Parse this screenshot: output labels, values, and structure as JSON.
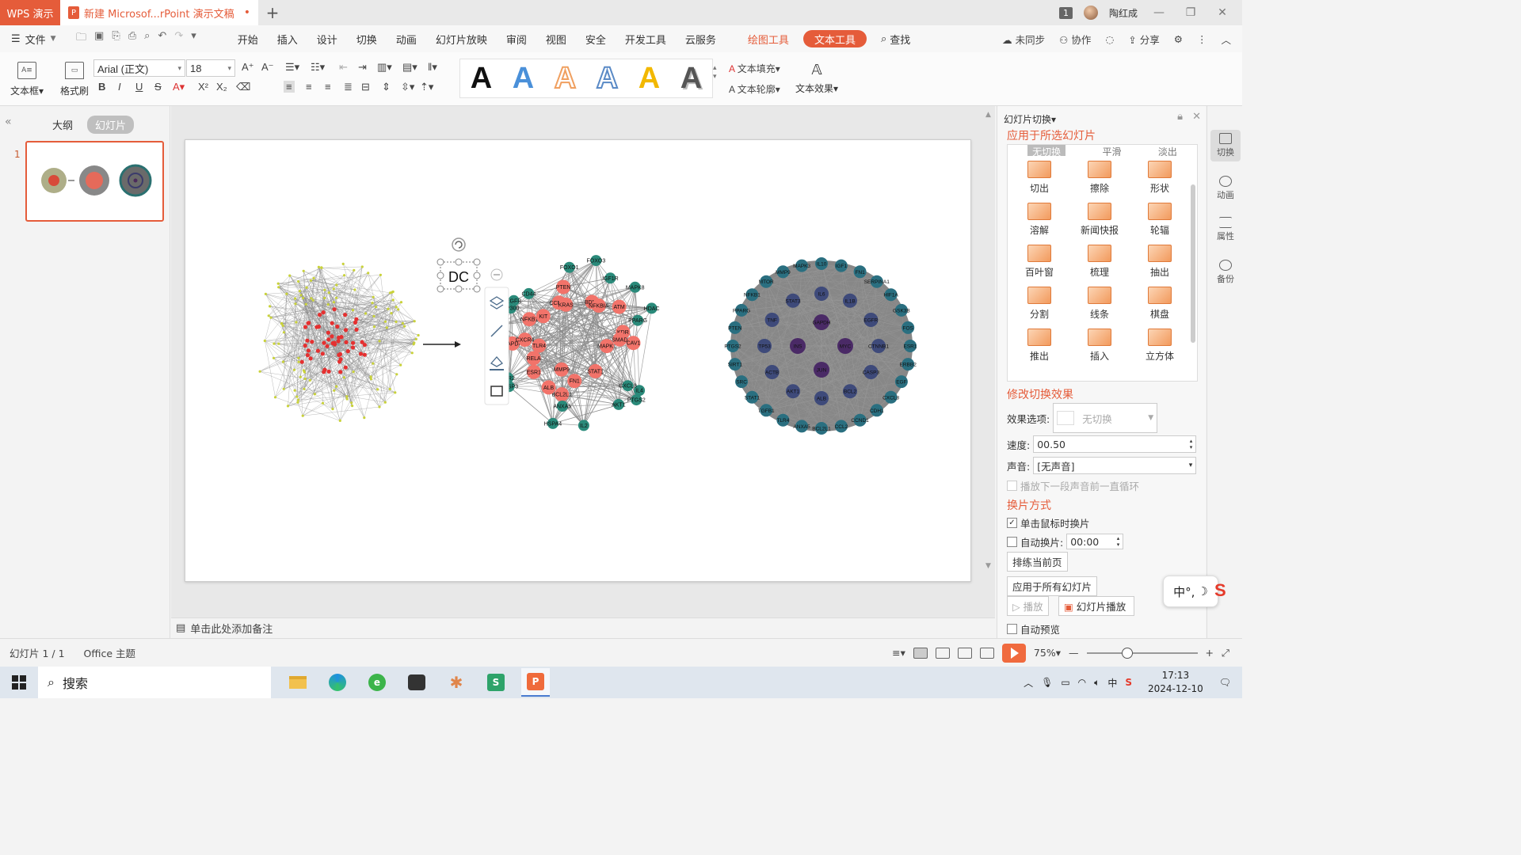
{
  "titlebar": {
    "app_tab": "WPS 演示",
    "doc_tab": "新建 Microsof...rPoint 演示文稿",
    "page_badge": "1",
    "user_name": "陶红成"
  },
  "menu": {
    "file": "文件",
    "tabs": [
      "开始",
      "插入",
      "设计",
      "切换",
      "动画",
      "幻灯片放映",
      "审阅",
      "视图",
      "安全",
      "开发工具",
      "云服务"
    ],
    "draw_tools": "绘图工具",
    "text_tools": "文本工具",
    "search": "查找",
    "right": [
      "未同步",
      "协作",
      "分享"
    ]
  },
  "ribbon": {
    "textbox": "文本框",
    "format_painter": "格式刷",
    "font_name": "Arial (正文)",
    "font_size": "18",
    "text_fill": "文本填充",
    "text_outline": "文本轮廓",
    "text_effect": "文本效果",
    "art_letter": "A",
    "art_colors": [
      "#111111",
      "#4a90d9",
      "#f0a060",
      "#5a8ac6",
      "#f2b800",
      "#555555"
    ]
  },
  "leftpane": {
    "outline_tab": "大纲",
    "slides_tab": "幻灯片",
    "slide_number": "1"
  },
  "slide": {
    "textbox_text": "DC",
    "network2_labels": [
      "CAV1",
      "MAPK1",
      "IL4",
      "PTGS2",
      "CXCL8",
      "AKT1",
      "STAT1",
      "IL2",
      "FN1",
      "BCL2L1",
      "ANXA5",
      "HSPA4",
      "MMP9",
      "ALB",
      "ESR1",
      "TLR2",
      "CASP3",
      "RELA",
      "GAPDH",
      "TLR4",
      "CXCR4",
      "IL6",
      "EP300",
      "NFKB1",
      "EGFR",
      "KIT",
      "CD44",
      "CCND1",
      "PTEN",
      "KRAS",
      "FOXO1",
      "FOXO3",
      "IGF1R",
      "BDNF",
      "NFKBIA",
      "MAPK8",
      "ATM",
      "PPARG",
      "HDAC",
      "KDR",
      "SMAD"
    ],
    "network3_labels": [
      "IL10",
      "IGF1",
      "FN1",
      "SERPINA1",
      "HIF1A",
      "GSK3B",
      "FOS",
      "ESR1",
      "ERBB2",
      "EGF",
      "CXCL8",
      "CDH1",
      "CCND1",
      "CCL2",
      "BCL2L1",
      "ANXA5",
      "TLR4",
      "TGFB1",
      "STAT1",
      "SRC",
      "SIRT1",
      "PTGS2",
      "PTEN",
      "PPARG",
      "NFKB1",
      "MTOR",
      "MMP9",
      "MAPK3",
      "IL6",
      "IL1B",
      "EGFR",
      "CTNNB1",
      "CASP3",
      "BCL2",
      "ALB",
      "AKT1",
      "ACTB",
      "TP53",
      "TNF",
      "STAT3",
      "MYC",
      "JUN",
      "INS",
      "GAPDH"
    ]
  },
  "notes": {
    "placeholder": "单击此处添加备注"
  },
  "rightpane": {
    "title": "幻灯片切换",
    "apply_header": "应用于所选幻灯片",
    "top_effects": [
      "无切换",
      "平滑",
      "淡出"
    ],
    "effects": [
      "切出",
      "擦除",
      "形状",
      "溶解",
      "新闻快报",
      "轮辐",
      "百叶窗",
      "梳理",
      "抽出",
      "分割",
      "线条",
      "棋盘",
      "推出",
      "插入",
      "立方体"
    ],
    "modify_header": "修改切换效果",
    "effect_option_label": "效果选项:",
    "effect_option_value": "无切换",
    "speed_label": "速度:",
    "speed_value": "00.50",
    "sound_label": "声音:",
    "sound_value": "[无声音]",
    "loop_label": "播放下一段声音前一直循环",
    "switch_header": "换片方式",
    "on_click_label": "单击鼠标时换片",
    "auto_label": "自动换片:",
    "auto_value": "00:00",
    "rehearse": "排练当前页",
    "apply_all": "应用于所有幻灯片",
    "play": "播放",
    "slideshow": "幻灯片播放",
    "auto_preview": "自动预览"
  },
  "sidestrip": [
    "切换",
    "动画",
    "属性",
    "备份"
  ],
  "ime": {
    "text": "中°,"
  },
  "status": {
    "slide_info": "幻灯片 1 / 1",
    "theme": "Office 主题",
    "zoom": "75%"
  },
  "taskbar": {
    "search": "搜索",
    "time": "17:13",
    "date": "2024-12-10"
  }
}
